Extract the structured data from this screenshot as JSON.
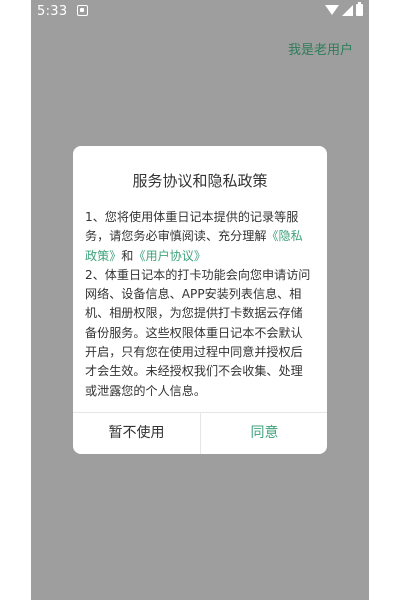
{
  "status_bar": {
    "time": "5:33",
    "icons": [
      "notification-icon",
      "wifi-icon",
      "signal-icon",
      "battery-icon"
    ]
  },
  "header": {
    "old_user_link": "我是老用户"
  },
  "dialog": {
    "title": "服务协议和隐私政策",
    "body": {
      "p1_prefix": "1、您将使用体重日记本提供的记录等服务，请您务必审慎阅读、充分理解",
      "privacy_link": "《隐私政策》",
      "and": "和",
      "user_agreement_link": "《用户协议》",
      "p2": "2、体重日记本的打卡功能会向您申请访问网络、设备信息、APP安装列表信息、相机、相册权限，为您提供打卡数据云存储备份服务。这些权限体重日记本不会默认开启，只有您在使用过程中同意并授权后才会生效。未经授权我们不会收集、处理或泄露您的个人信息。"
    },
    "decline_button": "暂不使用",
    "agree_button": "同意"
  },
  "colors": {
    "overlay": "#9e9e9e",
    "accent": "#3fa37c",
    "header_link": "#2e7d59"
  }
}
